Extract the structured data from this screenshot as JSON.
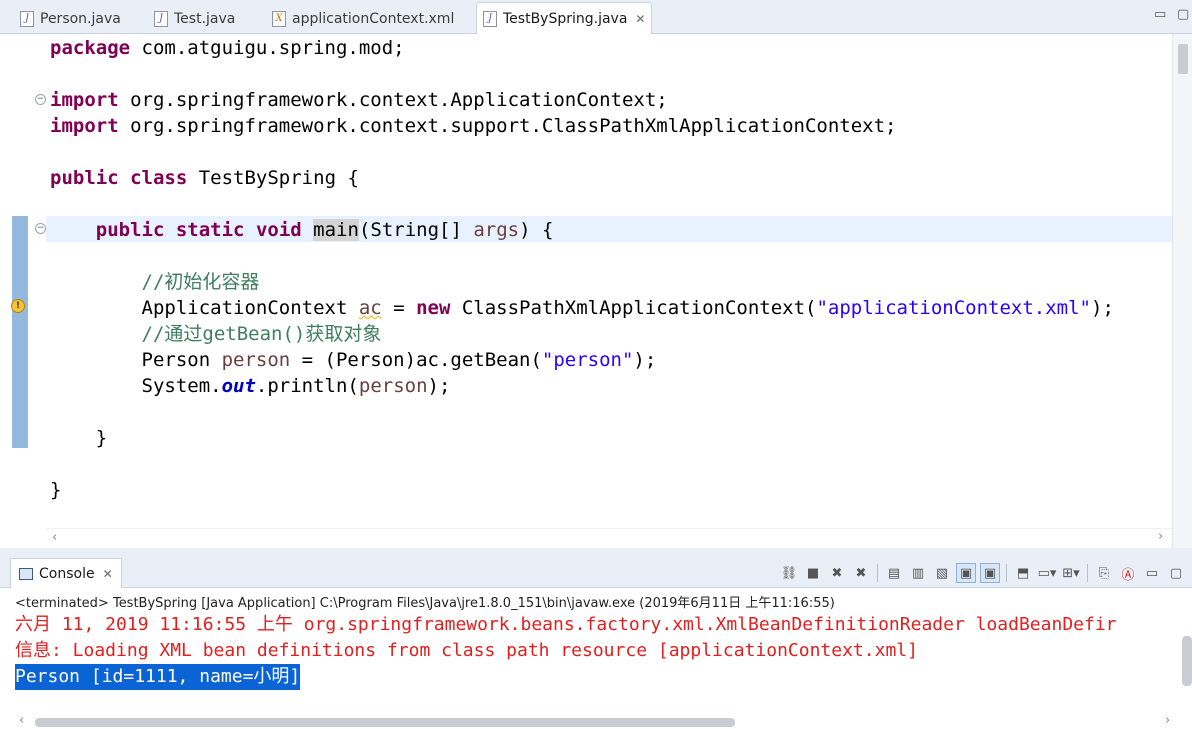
{
  "tabs": [
    {
      "label": "Person.java",
      "icon": "java-file-icon",
      "active": false
    },
    {
      "label": "Test.java",
      "icon": "java-file-icon",
      "active": false
    },
    {
      "label": "applicationContext.xml",
      "icon": "xml-file-icon",
      "active": false
    },
    {
      "label": "TestBySpring.java",
      "icon": "java-file-icon",
      "active": true
    }
  ],
  "editor": {
    "line1": {
      "kw": "package",
      "rest": " com.atguigu.spring.mod;"
    },
    "line2": {
      "kw": "import",
      "rest": " org.springframework.context.ApplicationContext;"
    },
    "line3": {
      "kw": "import",
      "rest": " org.springframework.context.support.ClassPathXmlApplicationContext;"
    },
    "line4": {
      "kw1": "public",
      "kw2": "class",
      "rest": " TestBySpring {"
    },
    "line5": {
      "kw1": "public",
      "kw2": "static",
      "kw3": "void",
      "method": "main",
      "p1": "(String[] ",
      "param": "args",
      "p2": ") {"
    },
    "line6": {
      "comment": "//初始化容器"
    },
    "line7": {
      "type": "ApplicationContext ",
      "var": "ac",
      "eq": " = ",
      "kw": "new",
      "ctor": " ClassPathXmlApplicationContext(",
      "str": "\"applicationContext.xml\"",
      "end": ");"
    },
    "line8": {
      "comment": "//通过getBean()获取对象"
    },
    "line9": {
      "type": "Person ",
      "var": "person",
      "mid": " = (Person)ac.getBean(",
      "str": "\"person\"",
      "end": ");"
    },
    "line10": {
      "pre": "System.",
      "field": "out",
      "mid": ".println(",
      "var": "person",
      "end": ");"
    },
    "line11": "}",
    "line12": "}"
  },
  "console": {
    "tab_label": "Console",
    "terminated": "<terminated> TestBySpring [Java Application] C:\\Program Files\\Java\\jre1.8.0_151\\bin\\javaw.exe (2019年6月11日 上午11:16:55)",
    "lines": [
      "六月 11, 2019 11:16:55 上午 org.springframework.beans.factory.xml.XmlBeanDefinitionReader loadBeanDefir",
      "信息: Loading XML bean definitions from class path resource [applicationContext.xml]",
      "Person [id=1111, name=小明]"
    ]
  },
  "colors": {
    "keyword": "#7f0055",
    "string": "#2a00ff",
    "comment": "#3f7f5f",
    "error_output": "#e02020",
    "selection": "#0a64d6"
  }
}
